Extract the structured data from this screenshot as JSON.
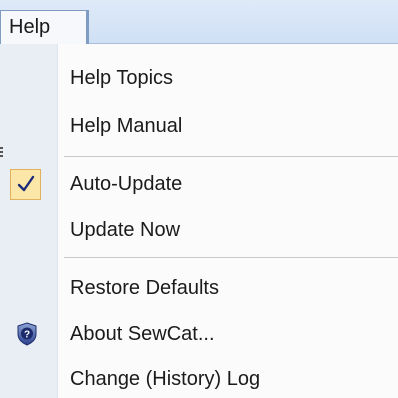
{
  "menubar": {
    "help_label": "Help"
  },
  "menu": {
    "items": [
      {
        "label": "Help Topics"
      },
      {
        "label": "Help Manual"
      },
      {
        "label": "Auto-Update",
        "checked": true
      },
      {
        "label": "Update Now"
      },
      {
        "label": "Restore Defaults"
      },
      {
        "label": "About SewCat...",
        "icon": "help-shield-icon"
      },
      {
        "label": "Change (History) Log"
      }
    ]
  },
  "colors": {
    "menubar_bg": "#d6e5f7",
    "gutter_bg": "#e9eef4",
    "check_highlight": "#fde7a8",
    "check_mark": "#1c2c7a"
  }
}
